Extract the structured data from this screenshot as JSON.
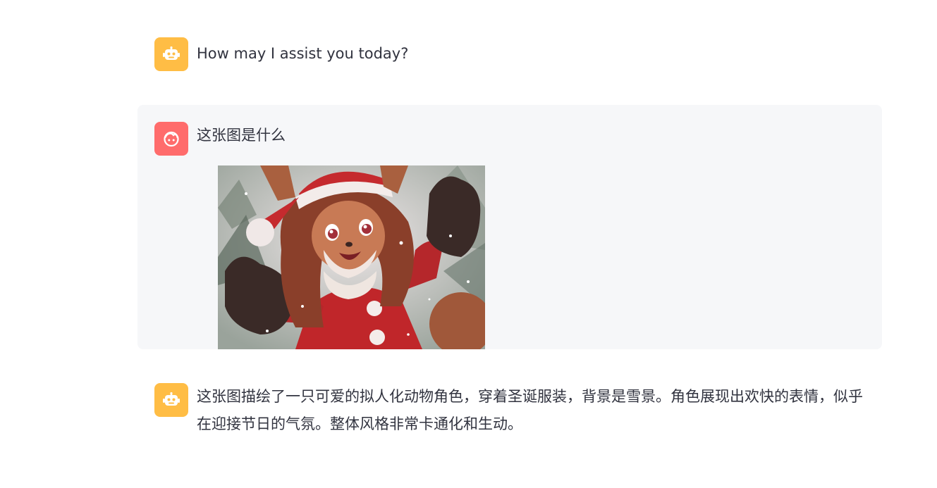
{
  "messages": [
    {
      "role": "assistant",
      "avatar_icon": "robot-icon",
      "avatar_color": "#ffbd45",
      "text": "How may I assist you today?"
    },
    {
      "role": "user",
      "avatar_icon": "user-face-icon",
      "avatar_color": "#ff6c6c",
      "text": "这张图是什么",
      "image": "fox-character-in-santa-outfit-illustration"
    },
    {
      "role": "assistant",
      "avatar_icon": "robot-icon",
      "avatar_color": "#ffbd45",
      "text": "这张图描绘了一只可爱的拟人化动物角色，穿着圣诞服装，背景是雪景。角色展现出欢快的表情，似乎在迎接节日的气氛。整体风格非常卡通化和生动。"
    }
  ],
  "colors": {
    "user_bubble_bg": "#f6f7f9",
    "text": "#31333f"
  }
}
